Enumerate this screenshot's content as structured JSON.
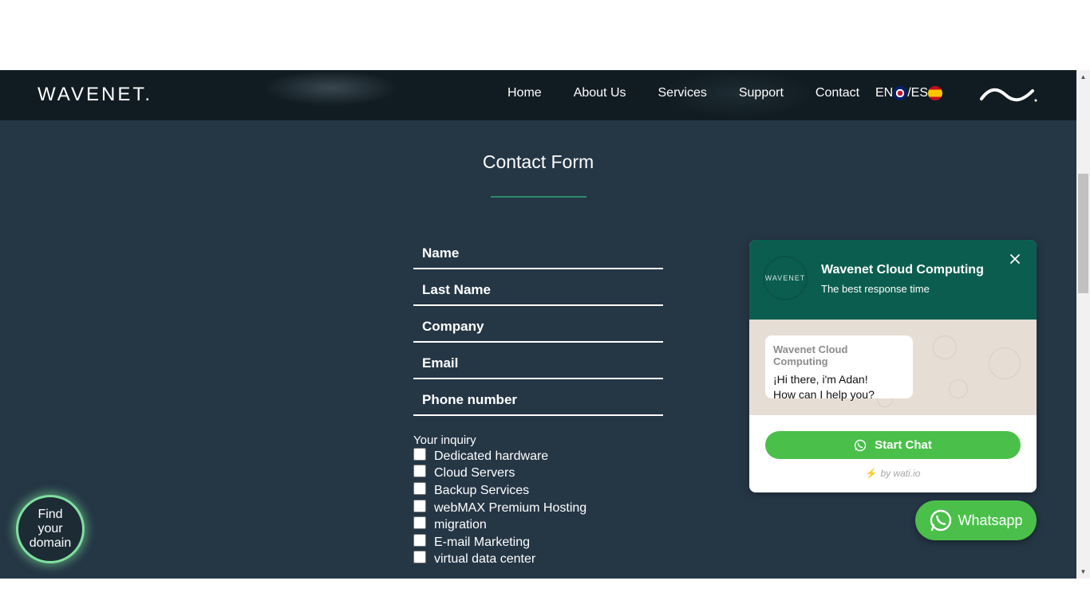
{
  "header": {
    "logo": "WAVENET.",
    "nav": [
      "Home",
      "About Us",
      "Services",
      "Support",
      "Contact"
    ],
    "lang_en": "EN",
    "lang_es": "/ES"
  },
  "form": {
    "title": "Contact Form",
    "fields": [
      "Name",
      "Last Name",
      "Company",
      "Email",
      "Phone number"
    ],
    "inquiry_label": "Your inquiry",
    "options": [
      "Dedicated hardware",
      "Cloud Servers",
      "Backup Services",
      "webMAX Premium Hosting",
      "migration",
      "E-mail Marketing",
      "virtual data center"
    ]
  },
  "find_domain": "Find your domain",
  "chat": {
    "avatar_text": "WAVENET",
    "name": "Wavenet Cloud Computing",
    "subtitle": "The best response time",
    "bubble_from": "Wavenet Cloud Computing",
    "bubble_line1": "¡Hi there, i'm Adan!",
    "bubble_line2": "How can I help you?",
    "start_label": "Start Chat",
    "powered": "by wati.io"
  },
  "whatsapp_label": "Whatsapp",
  "colors": {
    "page_bg": "#253645",
    "navbar_bg": "#111c22",
    "accent_green": "#4ac04a",
    "chat_header": "#0b5e4f"
  }
}
